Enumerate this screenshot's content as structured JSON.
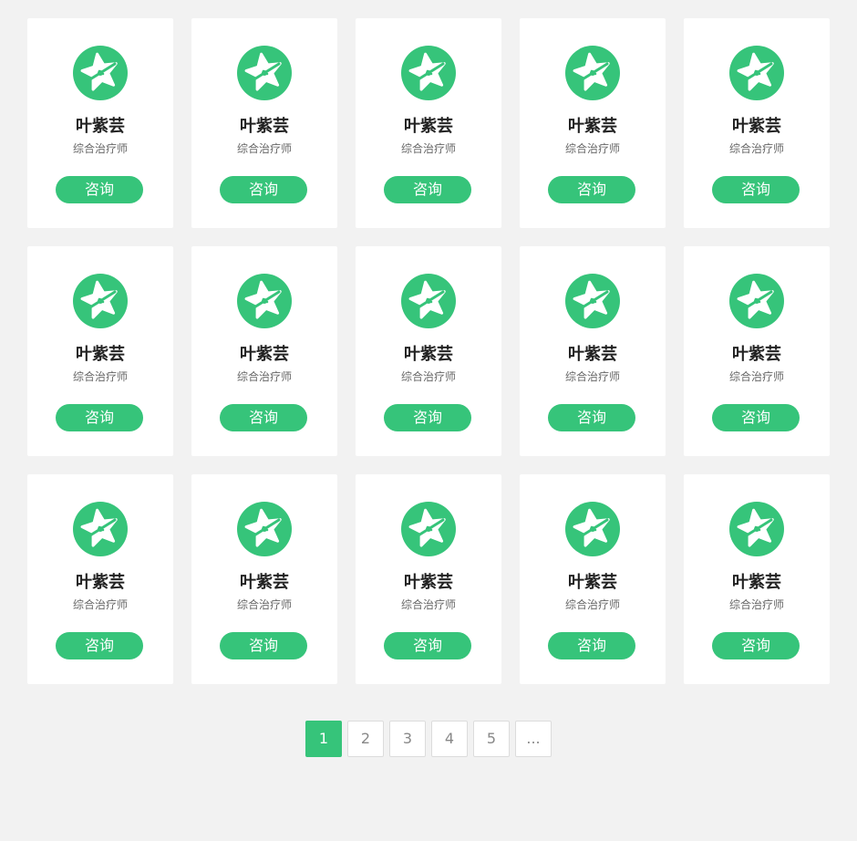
{
  "doctors": [
    {
      "name": "叶紫芸",
      "title": "综合治疗师",
      "button": "咨询"
    },
    {
      "name": "叶紫芸",
      "title": "综合治疗师",
      "button": "咨询"
    },
    {
      "name": "叶紫芸",
      "title": "综合治疗师",
      "button": "咨询"
    },
    {
      "name": "叶紫芸",
      "title": "综合治疗师",
      "button": "咨询"
    },
    {
      "name": "叶紫芸",
      "title": "综合治疗师",
      "button": "咨询"
    },
    {
      "name": "叶紫芸",
      "title": "综合治疗师",
      "button": "咨询"
    },
    {
      "name": "叶紫芸",
      "title": "综合治疗师",
      "button": "咨询"
    },
    {
      "name": "叶紫芸",
      "title": "综合治疗师",
      "button": "咨询"
    },
    {
      "name": "叶紫芸",
      "title": "综合治疗师",
      "button": "咨询"
    },
    {
      "name": "叶紫芸",
      "title": "综合治疗师",
      "button": "咨询"
    },
    {
      "name": "叶紫芸",
      "title": "综合治疗师",
      "button": "咨询"
    },
    {
      "name": "叶紫芸",
      "title": "综合治疗师",
      "button": "咨询"
    },
    {
      "name": "叶紫芸",
      "title": "综合治疗师",
      "button": "咨询"
    },
    {
      "name": "叶紫芸",
      "title": "综合治疗师",
      "button": "咨询"
    },
    {
      "name": "叶紫芸",
      "title": "综合治疗师",
      "button": "咨询"
    }
  ],
  "avatar_icon": "star-logo-icon",
  "pagination": {
    "pages": [
      "1",
      "2",
      "3",
      "4",
      "5",
      "..."
    ],
    "current": "1"
  },
  "colors": {
    "accent": "#36c47a",
    "background": "#f2f2f2",
    "card": "#ffffff"
  }
}
